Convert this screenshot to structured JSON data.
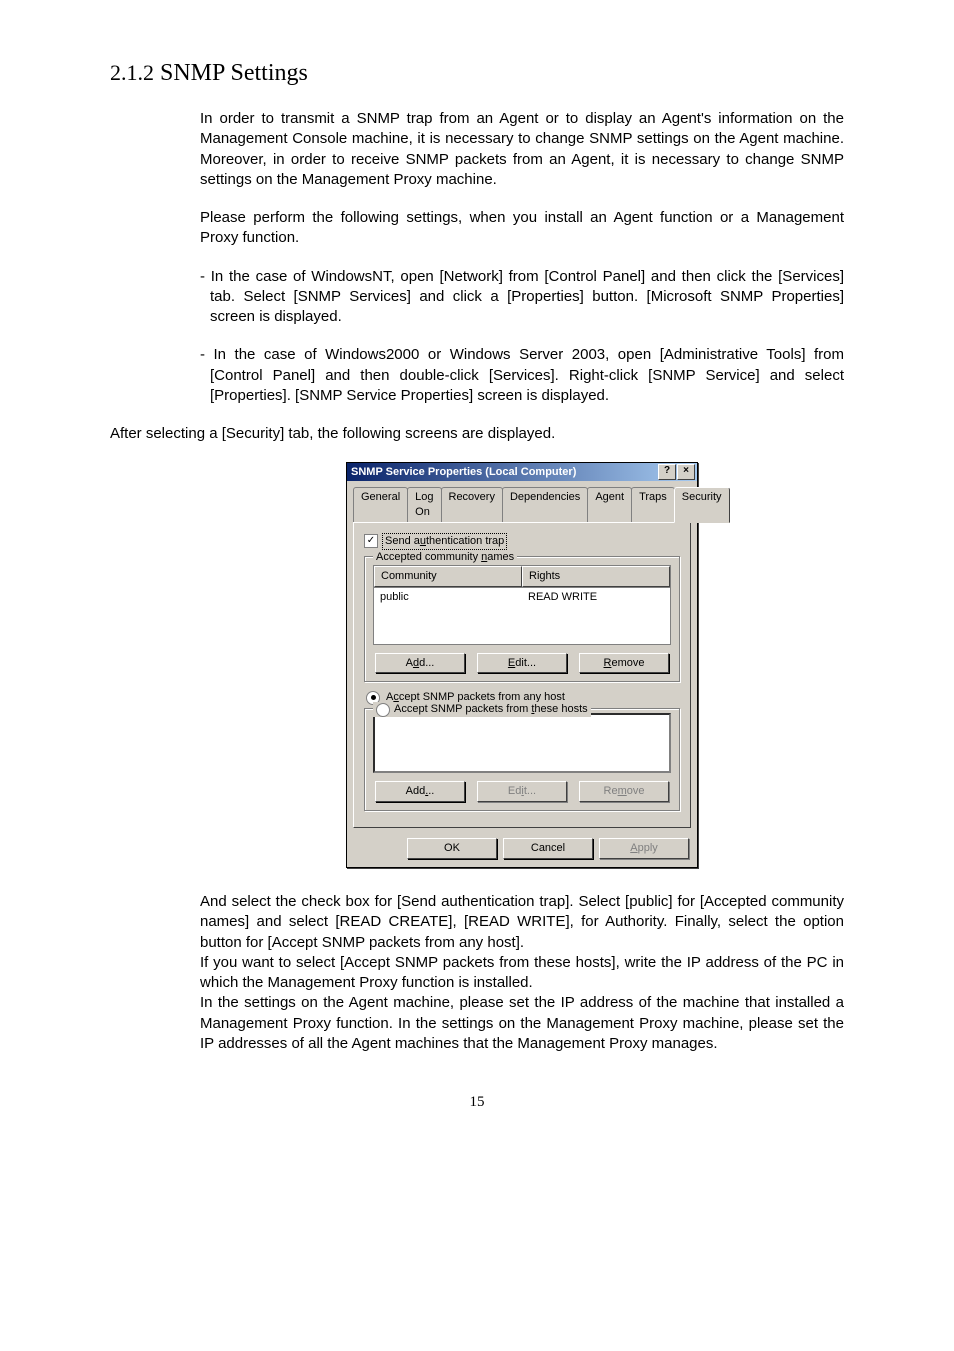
{
  "heading": {
    "number": "2.1.2",
    "title": "SNMP Settings"
  },
  "paragraphs": {
    "p1": "In order to transmit a SNMP trap from an Agent or to display an Agent's information on the Management Console machine, it is necessary to change SNMP settings on the Agent machine. Moreover, in order to receive SNMP packets from an Agent, it is necessary to change SNMP settings on the Management Proxy machine.",
    "p2": "Please perform the following settings, when you install an Agent function or a Management Proxy function.",
    "b1": "- In the case of WindowsNT, open [Network] from [Control Panel] and then click the [Services] tab. Select [SNMP Services] and click a [Properties] button. [Microsoft SNMP Properties] screen is displayed.",
    "b2": "- In the case of Windows2000 or Windows Server 2003, open [Administrative Tools] from [Control Panel] and then double-click [Services]. Right-click [SNMP Service] and select [Properties]. [SNMP Service Properties] screen is displayed.",
    "p3": "After selecting a [Security] tab, the following screens are displayed.",
    "p4": "And select the check box for [Send authentication trap]. Select [public] for [Accepted community names] and select [READ CREATE], [READ WRITE], for Authority. Finally, select the option button for [Accept SNMP packets from any host].",
    "p5": "If you want to select [Accept SNMP packets from these hosts], write the IP address of the PC in which the Management Proxy function is installed.",
    "p6": "In the settings on the Agent machine, please set the IP address of the machine that installed a Management Proxy function. In the settings on the Management Proxy machine, please set the IP addresses of all the Agent machines that the Management Proxy manages."
  },
  "dialog": {
    "title": "SNMP Service Properties (Local Computer)",
    "help": "?",
    "close": "×",
    "tabs": [
      "General",
      "Log On",
      "Recovery",
      "Dependencies",
      "Agent",
      "Traps",
      "Security"
    ],
    "active_tab": "Security",
    "send_auth_label": "Send authentication trap",
    "send_auth_checked": true,
    "group1_legend": "Accepted community names",
    "col_community": "Community",
    "col_rights": "Rights",
    "row_community": "public",
    "row_rights": "READ WRITE",
    "btn_add": "Add...",
    "btn_edit": "Edit...",
    "btn_remove": "Remove",
    "radio_any": "Accept SNMP packets from any host",
    "radio_these": "Accept SNMP packets from these hosts",
    "radio_selected": "any",
    "hosts_add": "Add...",
    "hosts_edit": "Edit...",
    "hosts_remove": "Remove",
    "ok": "OK",
    "cancel": "Cancel",
    "apply": "Apply"
  },
  "page_number": "15"
}
